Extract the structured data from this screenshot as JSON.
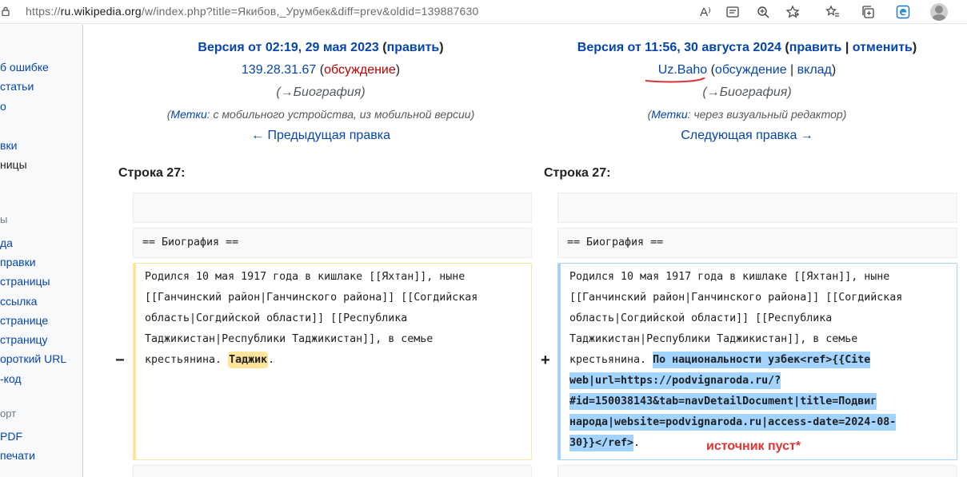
{
  "browser": {
    "url_prefix": "https://",
    "url_host": "ru.wikipedia.org",
    "url_path": "/w/index.php?title=Якибов,_Урумбек&diff=prev&oldid=139887630",
    "read_aloud_label": "A⁾"
  },
  "sidebar": {
    "items": [
      "б ошибке",
      " статьи",
      "о",
      "вки",
      "ницы"
    ],
    "section_tools": "ы",
    "tools": [
      "да",
      "правки",
      " страницы",
      " ссылка",
      " странице",
      " страницу",
      "ороткий URL",
      "-код"
    ],
    "section_export": "орт",
    "export": [
      " PDF",
      " печати"
    ]
  },
  "left": {
    "version_prefix": "Версия от 02:19, 29 мая 2023",
    "edit_label": "править",
    "author": "139.28.31.67",
    "talk_label": "обсуждение",
    "summary": "(→Биография)",
    "tags_label": "Метки",
    "tags_text": ": с мобильного устройства, из мобильной версии",
    "nav": "← Предыдущая правка",
    "line_label": "Строка 27:",
    "context_heading": "== Биография ==",
    "para_lines": [
      "Родился 10 мая 1917 года в кишлаке [[Яхтан]], ныне",
      "[[Ганчинский район|Ганчинского района]] [[Согдийская",
      "область|Согдийской области]] [[Республика",
      "Таджикистан|Республики Таджикистан]], в семье"
    ],
    "last_line_plain": "крестьянина. ",
    "last_line_changed": "Таджик",
    "last_line_tail": ".",
    "marker": "−"
  },
  "right": {
    "version_prefix": "Версия от 11:56, 30 августа 2024",
    "edit_label": "править",
    "undo_label": "отменить",
    "author": "Uz.Baho",
    "talk_label": "обсуждение",
    "contrib_label": "вклад",
    "summary": "(→Биография)",
    "tags_label": "Метки",
    "tags_text": ": через визуальный редактор",
    "nav": "Следующая правка →",
    "line_label": "Строка 27:",
    "context_heading": "== Биография ==",
    "para_lines": [
      "Родился 10 мая 1917 года в кишлаке [[Яхтан]], ныне",
      "[[Ганчинский район|Ганчинского района]] [[Согдийская",
      "область|Согдийской области]] [[Республика",
      "Таджикистан|Республики Таджикистан]], в семье"
    ],
    "line5_plain": "крестьянина. ",
    "line5_added": "По национальности узбек<ref>{{Cite",
    "added_lines": [
      "web|url=https://podvignaroda.ru/?",
      "#id=150038143&tab=navDetailDocument|title=Подвиг",
      "народа|website=podvignaroda.ru|access-date=2024-08-"
    ],
    "last_added": "30}}</ref>",
    "last_tail": ".",
    "marker": "+",
    "annotation": "источник пуст*"
  },
  "colors": {
    "link": "#0645ad",
    "redlink": "#ba0000",
    "deleted": "#ffe49c",
    "added": "#a3d3ff",
    "annotation": "#d33"
  }
}
